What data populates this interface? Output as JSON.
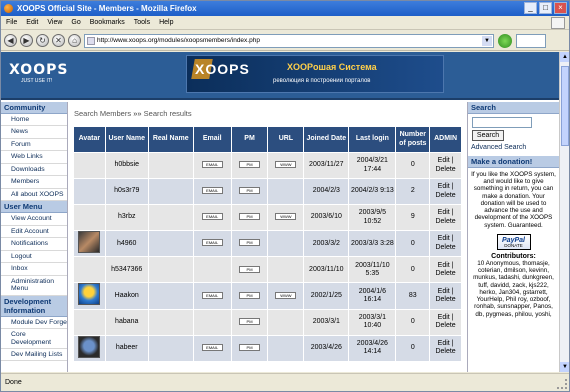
{
  "window": {
    "title": "XOOPS Official Site - Members - Mozilla Firefox",
    "min": "_",
    "max": "□",
    "close": "×"
  },
  "menu": [
    "File",
    "Edit",
    "View",
    "Go",
    "Bookmarks",
    "Tools",
    "Help"
  ],
  "nav": {
    "url": "http://www.xoops.org/modules/xoopsmembers/index.php"
  },
  "status": "Done",
  "header": {
    "logo": "XOOPS",
    "tagline": "JUST USE IT!",
    "banner_logo": "XOOPS",
    "banner_title": "XOOPошая Система",
    "banner_subtitle": "революция в построении порталов"
  },
  "left": {
    "sections": [
      {
        "title": "Community",
        "items": [
          "Home",
          "News",
          "Forum",
          "Web Links",
          "Downloads",
          "Members",
          "All about XOOPS"
        ]
      },
      {
        "title": "User Menu",
        "items": [
          "View Account",
          "Edit Account",
          "Notifications",
          "Logout",
          "Inbox",
          "Administration Menu"
        ]
      },
      {
        "title": "Development Information",
        "items": [
          "Module Dev Forge",
          "Core Development",
          "Dev Mailing Lists"
        ]
      }
    ]
  },
  "breadcrumb": {
    "link": "Search Members",
    "sep": "»»",
    "current": "Search results"
  },
  "table": {
    "headers": [
      "Avatar",
      "User Name",
      "Real Name",
      "Email",
      "PM",
      "URL",
      "Joined Date",
      "Last login",
      "Number of posts",
      "ADMIN"
    ],
    "rows": [
      {
        "user": "h0bbsie",
        "email": true,
        "url": true,
        "joined": "2003/11/27",
        "last": "2004/3/21 17:44",
        "posts": "0",
        "avatar": ""
      },
      {
        "user": "h0s3r79",
        "email": true,
        "url": false,
        "joined": "2004/2/3",
        "last": "2004/2/3 9:13",
        "posts": "2",
        "avatar": ""
      },
      {
        "user": "h3rbz",
        "email": true,
        "url": true,
        "joined": "2003/6/10",
        "last": "2003/9/5 10:52",
        "posts": "9",
        "avatar": ""
      },
      {
        "user": "h4960",
        "email": true,
        "url": false,
        "joined": "2003/3/2",
        "last": "2003/3/3 3:28",
        "posts": "0",
        "avatar": "av1"
      },
      {
        "user": "h5347366",
        "email": false,
        "url": false,
        "joined": "2003/11/10",
        "last": "2003/11/10 5:35",
        "posts": "0",
        "avatar": ""
      },
      {
        "user": "Haakon",
        "email": true,
        "url": true,
        "joined": "2002/1/25",
        "last": "2004/1/6 16:14",
        "posts": "83",
        "avatar": "av2"
      },
      {
        "user": "habana",
        "email": false,
        "url": false,
        "joined": "2003/3/1",
        "last": "2003/3/1 10:40",
        "posts": "0",
        "avatar": ""
      },
      {
        "user": "habeer",
        "email": true,
        "url": false,
        "joined": "2003/4/26",
        "last": "2003/4/26 14:14",
        "posts": "0",
        "avatar": "av3"
      }
    ],
    "email_label": "EMAIL",
    "pm_label": "PM",
    "www_label": "WWW",
    "admin": {
      "edit": "Edit",
      "delete": "Delete",
      "sep": "|"
    }
  },
  "right": {
    "search_title": "Search",
    "search_button": "Search",
    "advanced": "Advanced Search",
    "donate_title": "Make a donation!",
    "donate_text": "If you like the XOOPS system, and would like to give something in return, you can make a donation. Your donation will be used to advance the use and development of the XOOPS system. Guaranteed.",
    "paypal": "PayPal",
    "paypal_sub": "DONATE",
    "contrib_title": "Contributors:",
    "contrib_list": "10 Anonymous, thomasje, coterian, dmilson, kevinn, munkus, tadashi, dunkgreen, tuff, davidd, zack, kjs222, herko, Jan304, gstarrett, YourHelp, Phil roy, ozboof, ronhab, sunsnapper, Panos, db, pygmeas, philou, yoshi,"
  }
}
